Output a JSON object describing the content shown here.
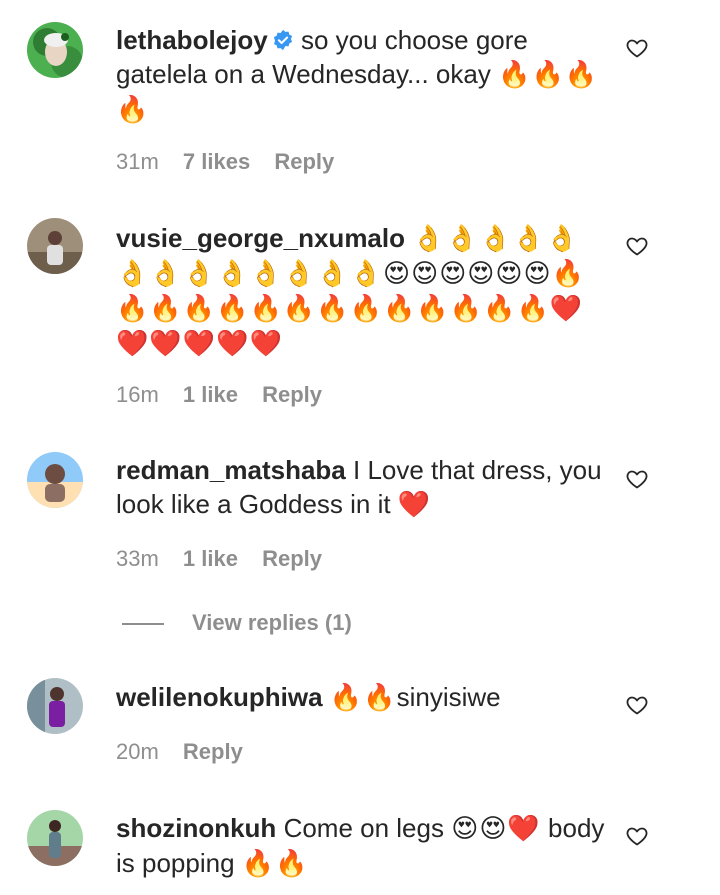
{
  "colors": {
    "text": "#262626",
    "meta": "#8e8e8e",
    "verified": "#3897f0"
  },
  "comments": [
    {
      "username": "lethabolejoy",
      "verified": true,
      "text": "so you choose gore gatelela on a Wednesday... okay",
      "emojis": "🔥🔥🔥🔥",
      "time": "31m",
      "likes": "7 likes",
      "reply": "Reply"
    },
    {
      "username": "vusie_george_nxumalo",
      "verified": false,
      "text": "",
      "emojis": "👌👌👌👌👌👌👌👌👌👌👌👌👌😍😍😍😍😍😍🔥🔥🔥🔥🔥🔥🔥🔥🔥🔥🔥🔥🔥🔥❤️❤️❤️❤️❤️❤️",
      "time": "16m",
      "likes": "1 like",
      "reply": "Reply"
    },
    {
      "username": "redman_matshaba",
      "verified": false,
      "text": "I Love that dress, you look like a Goddess in it",
      "emojis": "❤️",
      "time": "33m",
      "likes": "1 like",
      "reply": "Reply"
    },
    {
      "username": "welilenokuphiwa",
      "verified": false,
      "text": "",
      "emojis": "🔥🔥",
      "text_after": "sinyisiwe",
      "time": "20m",
      "likes": "",
      "reply": "Reply"
    },
    {
      "username": "shozinonkuh",
      "verified": false,
      "text": "Come on legs",
      "emojis": "😍😍❤️",
      "text_after": "body is popping",
      "emojis_after": "🔥🔥",
      "time": "",
      "likes": "",
      "reply": ""
    }
  ],
  "view_replies": "View replies (1)",
  "icons": {
    "like": "heart-outline-icon",
    "verified": "verified-badge-icon"
  }
}
